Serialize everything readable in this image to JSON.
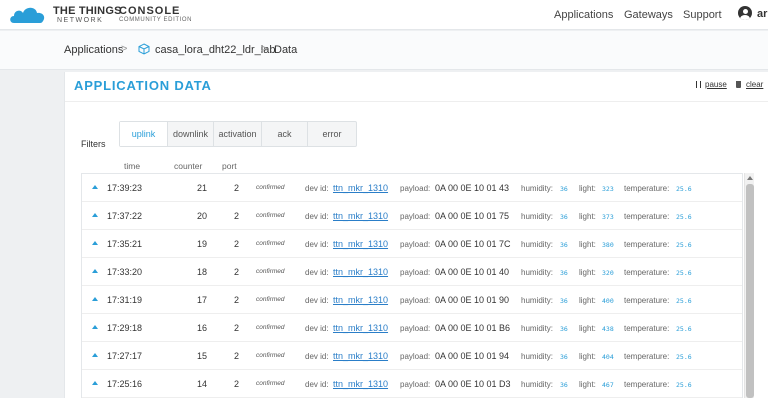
{
  "header": {
    "brand_line1": "THE THINGS",
    "brand_line2": "NETWORK",
    "console_title": "CONSOLE",
    "console_subtitle": "COMMUNITY EDITION",
    "nav": [
      "Applications",
      "Gateways",
      "Support"
    ],
    "user": "ar"
  },
  "breadcrumb": {
    "items": [
      "Applications",
      "casa_lora_dht22_ldr_lab",
      "Data"
    ],
    "separator": ">"
  },
  "panel": {
    "title": "APPLICATION DATA",
    "pause_label": "pause",
    "clear_label": "clear"
  },
  "filters": {
    "label": "Filters",
    "tabs": [
      "uplink",
      "downlink",
      "activation",
      "ack",
      "error"
    ],
    "active": "uplink"
  },
  "columns": [
    "time",
    "counter",
    "port"
  ],
  "field_labels": {
    "dev_id": "dev id:",
    "payload": "payload:",
    "humidity": "humidity:",
    "light": "light:",
    "temperature": "temperature:"
  },
  "rows": [
    {
      "time": "17:39:23",
      "counter": "21",
      "port": "2",
      "status": "confirmed",
      "dev_id": "ttn_mkr_1310",
      "payload": "0A 00 0E 10 01 43",
      "humidity": "36",
      "light": "323",
      "temperature": "25.6"
    },
    {
      "time": "17:37:22",
      "counter": "20",
      "port": "2",
      "status": "confirmed",
      "dev_id": "ttn_mkr_1310",
      "payload": "0A 00 0E 10 01 75",
      "humidity": "36",
      "light": "373",
      "temperature": "25.6"
    },
    {
      "time": "17:35:21",
      "counter": "19",
      "port": "2",
      "status": "confirmed",
      "dev_id": "ttn_mkr_1310",
      "payload": "0A 00 0E 10 01 7C",
      "humidity": "36",
      "light": "380",
      "temperature": "25.6"
    },
    {
      "time": "17:33:20",
      "counter": "18",
      "port": "2",
      "status": "confirmed",
      "dev_id": "ttn_mkr_1310",
      "payload": "0A 00 0E 10 01 40",
      "humidity": "36",
      "light": "320",
      "temperature": "25.6"
    },
    {
      "time": "17:31:19",
      "counter": "17",
      "port": "2",
      "status": "confirmed",
      "dev_id": "ttn_mkr_1310",
      "payload": "0A 00 0E 10 01 90",
      "humidity": "36",
      "light": "400",
      "temperature": "25.6"
    },
    {
      "time": "17:29:18",
      "counter": "16",
      "port": "2",
      "status": "confirmed",
      "dev_id": "ttn_mkr_1310",
      "payload": "0A 00 0E 10 01 B6",
      "humidity": "36",
      "light": "438",
      "temperature": "25.6"
    },
    {
      "time": "17:27:17",
      "counter": "15",
      "port": "2",
      "status": "confirmed",
      "dev_id": "ttn_mkr_1310",
      "payload": "0A 00 0E 10 01 94",
      "humidity": "36",
      "light": "404",
      "temperature": "25.6"
    },
    {
      "time": "17:25:16",
      "counter": "14",
      "port": "2",
      "status": "confirmed",
      "dev_id": "ttn_mkr_1310",
      "payload": "0A 00 0E 10 01 D3",
      "humidity": "36",
      "light": "467",
      "temperature": "25.6"
    }
  ],
  "colors": {
    "accent": "#2a9ed8",
    "link": "#2a7ec8"
  }
}
